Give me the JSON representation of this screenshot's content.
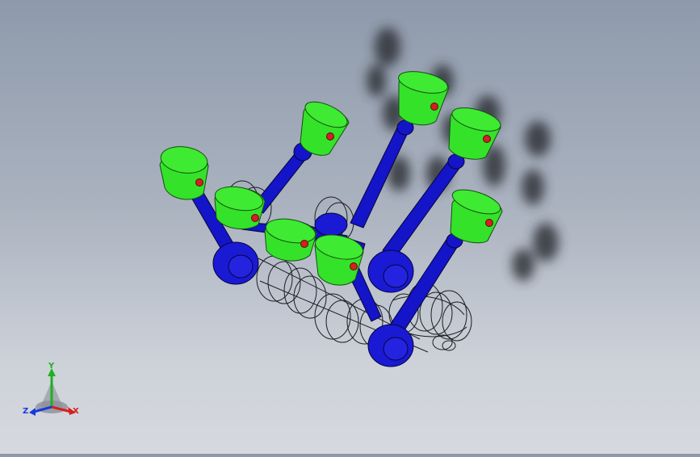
{
  "viewport": {
    "model": "v8-crankshaft-piston-assembly",
    "piston_color": "#35e22a",
    "rod_color": "#1414c8",
    "pin_color": "#d42020"
  },
  "triad": {
    "x_label": "X",
    "y_label": "Y",
    "z_label": "Z",
    "x_color": "#d42020",
    "y_color": "#20b020",
    "z_color": "#1a3ad8"
  }
}
